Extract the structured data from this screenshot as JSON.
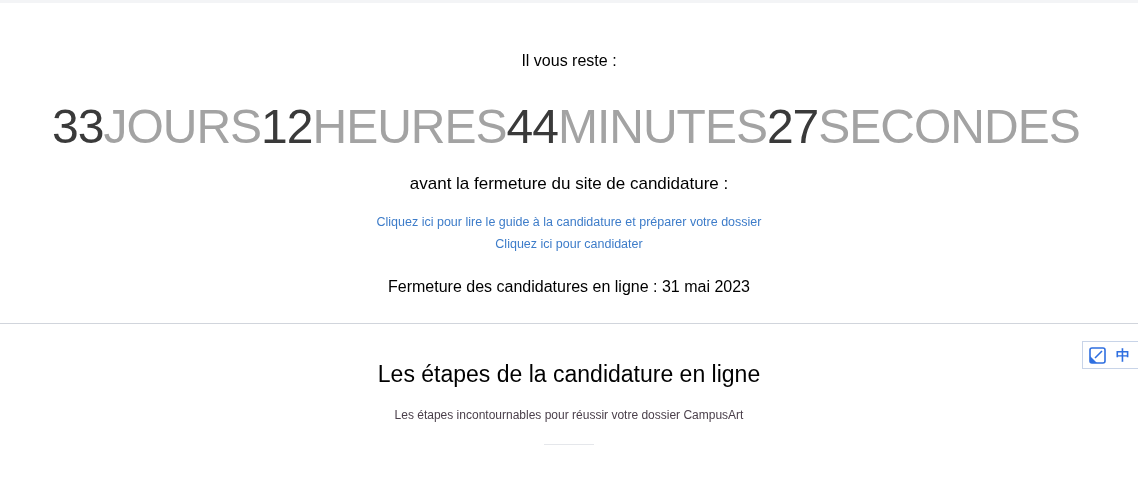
{
  "intro": "Il vous reste :",
  "countdown": [
    {
      "value": "33",
      "unit": "JOURS"
    },
    {
      "value": "12",
      "unit": "HEURES"
    },
    {
      "value": "44",
      "unit": "MINUTES"
    },
    {
      "value": "27",
      "unit": "SECONDES"
    }
  ],
  "subtitle": "avant la fermeture du site de candidature :",
  "links": [
    "Cliquez ici pour lire le guide à la candidature et préparer votre dossier",
    "Cliquez ici pour candidater"
  ],
  "closing": "Fermeture des candidatures en ligne : 31 mai 2023",
  "section": {
    "title": "Les étapes de la candidature en ligne",
    "subtitle": "Les étapes incontournables pour réussir votre dossier CampusArt"
  },
  "widget": {
    "label": "中"
  }
}
